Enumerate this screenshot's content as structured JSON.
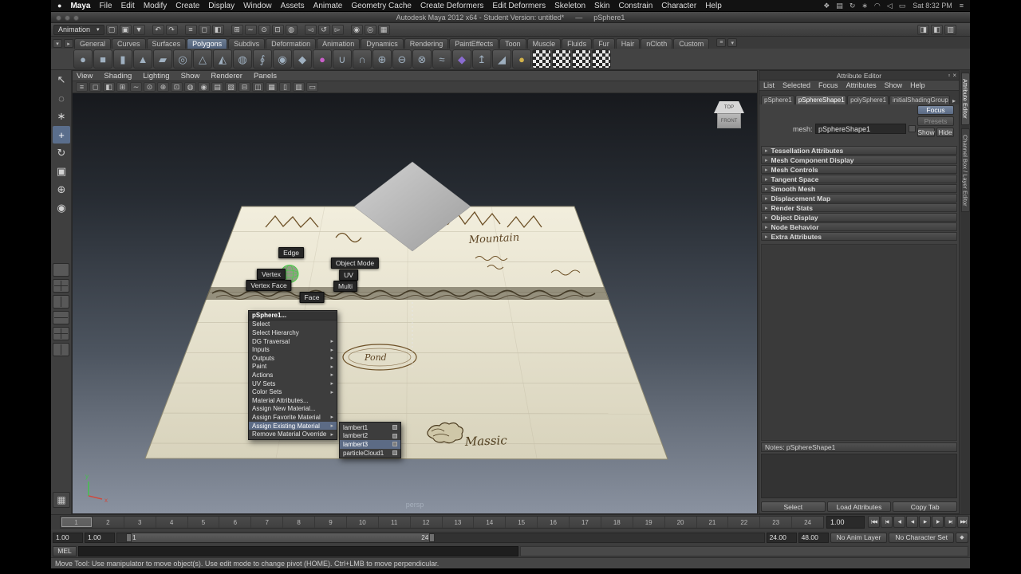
{
  "menubar": {
    "apple_icon": "●",
    "app_name": "Maya",
    "items": [
      "File",
      "Edit",
      "Modify",
      "Create",
      "Display",
      "Window",
      "Assets",
      "Animate",
      "Geometry Cache",
      "Create Deformers",
      "Edit Deformers",
      "Skeleton",
      "Skin",
      "Constrain",
      "Character",
      "Help"
    ],
    "status_icons": [
      {
        "name": "spaces-icon",
        "glyph": "❖"
      },
      {
        "name": "display-icon",
        "glyph": "▤"
      },
      {
        "name": "time-machine-icon",
        "glyph": "↻"
      },
      {
        "name": "bluetooth-icon",
        "glyph": "∗"
      },
      {
        "name": "wifi-icon",
        "glyph": "◠"
      },
      {
        "name": "volume-icon",
        "glyph": "◁"
      },
      {
        "name": "battery-icon",
        "glyph": "▭"
      }
    ],
    "clock": "Sat 8:32 PM",
    "user_menu_icon": "≡"
  },
  "titlebar": {
    "title": "Autodesk Maya 2012 x64 - Student Version: untitled*",
    "separator": "—",
    "document": "pSphere1"
  },
  "statusline": {
    "menuset": "Animation",
    "caret": "▾",
    "icons": [
      {
        "name": "new-scene-icon",
        "glyph": "▢"
      },
      {
        "name": "open-scene-icon",
        "glyph": "▣"
      },
      {
        "name": "save-scene-icon",
        "glyph": "▼"
      },
      {
        "name": "undo-icon",
        "glyph": "↶",
        "cls": "gs"
      },
      {
        "name": "redo-icon",
        "glyph": "↷"
      },
      {
        "name": "select-hierarchy-icon",
        "glyph": "≡",
        "cls": "gs"
      },
      {
        "name": "select-object-icon",
        "glyph": "◻"
      },
      {
        "name": "select-component-icon",
        "glyph": "◧"
      },
      {
        "name": "snap-grid-icon",
        "glyph": "⊞",
        "cls": "gs"
      },
      {
        "name": "snap-curve-icon",
        "glyph": "∼"
      },
      {
        "name": "snap-point-icon",
        "glyph": "⊙"
      },
      {
        "name": "snap-plane-icon",
        "glyph": "⊡"
      },
      {
        "name": "make-live-icon",
        "glyph": "◍"
      },
      {
        "name": "input-connections-icon",
        "glyph": "◅",
        "cls": "gs"
      },
      {
        "name": "construction-history-icon",
        "glyph": "↺"
      },
      {
        "name": "output-connections-icon",
        "glyph": "▻"
      },
      {
        "name": "render-icon",
        "glyph": "◉",
        "cls": "gs"
      },
      {
        "name": "ipr-render-icon",
        "glyph": "◎"
      },
      {
        "name": "render-settings-icon",
        "glyph": "▦"
      }
    ],
    "right_icons": [
      {
        "name": "show-attribute-editor-icon",
        "glyph": "◨"
      },
      {
        "name": "show-tool-settings-icon",
        "glyph": "◧"
      },
      {
        "name": "show-channel-box-icon",
        "glyph": "▥"
      }
    ]
  },
  "shelf": {
    "arrow_icons": [
      {
        "name": "shelf-tab-toggle-icon",
        "glyph": "▾"
      },
      {
        "name": "shelf-menu-icon",
        "glyph": "▸"
      }
    ],
    "tabs": [
      {
        "label": "General"
      },
      {
        "label": "Curves"
      },
      {
        "label": "Surfaces"
      },
      {
        "label": "Polygons",
        "cls": "active"
      },
      {
        "label": "Subdivs"
      },
      {
        "label": "Deformation"
      },
      {
        "label": "Animation"
      },
      {
        "label": "Dynamics"
      },
      {
        "label": "Rendering"
      },
      {
        "label": "PaintEffects"
      },
      {
        "label": "Toon"
      },
      {
        "label": "Muscle"
      },
      {
        "label": "Fluids"
      },
      {
        "label": "Fur"
      },
      {
        "label": "Hair"
      },
      {
        "label": "nCloth"
      },
      {
        "label": "Custom"
      }
    ],
    "right_icons": [
      {
        "name": "shelf-editor-icon",
        "glyph": "≡"
      },
      {
        "name": "shelf-overflow-icon",
        "glyph": "▾"
      }
    ],
    "icons": [
      {
        "name": "poly-sphere-icon",
        "glyph": "●"
      },
      {
        "name": "poly-cube-icon",
        "glyph": "■"
      },
      {
        "name": "poly-cylinder-icon",
        "glyph": "▮"
      },
      {
        "name": "poly-cone-icon",
        "glyph": "▲"
      },
      {
        "name": "poly-plane-icon",
        "glyph": "▰"
      },
      {
        "name": "poly-torus-icon",
        "glyph": "◎"
      },
      {
        "name": "poly-prism-icon",
        "glyph": "△"
      },
      {
        "name": "poly-pyramid-icon",
        "glyph": "◭"
      },
      {
        "name": "poly-pipe-icon",
        "glyph": "◍"
      },
      {
        "name": "poly-helix-icon",
        "glyph": "∮"
      },
      {
        "name": "poly-soccerball-icon",
        "glyph": "◉"
      },
      {
        "name": "poly-platonic-icon",
        "glyph": "◆"
      },
      {
        "name": "sculpt-geometry-icon",
        "glyph": "●",
        "color": "#c95fc9"
      },
      {
        "name": "combine-icon",
        "glyph": "∪"
      },
      {
        "name": "separate-icon",
        "glyph": "∩"
      },
      {
        "name": "boolean-union-icon",
        "glyph": "⊕"
      },
      {
        "name": "boolean-difference-icon",
        "glyph": "⊖"
      },
      {
        "name": "boolean-intersection-icon",
        "glyph": "⊗"
      },
      {
        "name": "smooth-icon",
        "glyph": "≈"
      },
      {
        "name": "mirror-geometry-icon",
        "glyph": "◆",
        "color": "#8a6cd0"
      },
      {
        "name": "extrude-icon",
        "glyph": "↥"
      },
      {
        "name": "bevel-icon",
        "glyph": "◢"
      },
      {
        "name": "spherical-mapping-icon",
        "glyph": "●",
        "color": "#d2b24a"
      },
      {
        "name": "planar-mapping-icon",
        "glyph": "",
        "cls": "checker"
      },
      {
        "name": "cylindrical-mapping-icon",
        "glyph": "",
        "cls": "checker"
      },
      {
        "name": "automatic-mapping-icon",
        "glyph": "",
        "cls": "checker"
      },
      {
        "name": "uv-texture-editor-icon",
        "glyph": "",
        "cls": "checker"
      }
    ]
  },
  "toolbox": {
    "tools": [
      {
        "name": "select-tool",
        "glyph": "↖"
      },
      {
        "name": "lasso-select-tool",
        "glyph": "◌"
      },
      {
        "name": "paint-select-tool",
        "glyph": "∗"
      },
      {
        "name": "move-tool",
        "glyph": "+",
        "cls": "active"
      },
      {
        "name": "rotate-tool",
        "glyph": "↻"
      },
      {
        "name": "scale-tool",
        "glyph": "▣"
      },
      {
        "name": "universal-manipulator-tool",
        "glyph": "⊕"
      },
      {
        "name": "soft-modification-tool",
        "glyph": "◉"
      }
    ],
    "layouts": [
      {
        "name": "single-pane-layout",
        "cls": "lay1"
      },
      {
        "name": "four-pane-layout",
        "cls": "lay2"
      },
      {
        "name": "two-pane-vertical-layout",
        "cls": "lay3"
      },
      {
        "name": "two-pane-horizontal-layout",
        "cls": "lay4"
      },
      {
        "name": "three-pane-layout",
        "cls": "lay2"
      },
      {
        "name": "outliner-persp-layout",
        "cls": "lay3"
      }
    ],
    "bottom_icon_glyph": "▦"
  },
  "viewport": {
    "menus": [
      "View",
      "Shading",
      "Lighting",
      "Show",
      "Renderer",
      "Panels"
    ],
    "toolbar_icons": [
      {
        "name": "select-by-hierarchy-icon",
        "glyph": "≡"
      },
      {
        "name": "select-by-object-icon",
        "glyph": "◻"
      },
      {
        "name": "select-by-component-icon",
        "glyph": "◧"
      },
      {
        "name": "snap-to-grids-icon",
        "glyph": "⊞"
      },
      {
        "name": "snap-to-curves-icon",
        "glyph": "∼"
      },
      {
        "name": "snap-to-points-icon",
        "glyph": "⊙"
      },
      {
        "name": "snap-to-projected-center-icon",
        "glyph": "⊕"
      },
      {
        "name": "snap-to-view-planes-icon",
        "glyph": "⊡"
      },
      {
        "name": "make-live-icon",
        "glyph": "◍"
      },
      {
        "name": "camera-attributes-icon",
        "glyph": "◉"
      },
      {
        "name": "bookmark-icon",
        "glyph": "▤"
      },
      {
        "name": "image-plane-icon",
        "glyph": "▧"
      },
      {
        "name": "two-d-pan-zoom-icon",
        "glyph": "⊟"
      },
      {
        "name": "isolate-select-icon",
        "glyph": "◫"
      },
      {
        "name": "field-chart-icon",
        "glyph": "▦"
      },
      {
        "name": "resolution-gate-icon",
        "glyph": "▯"
      },
      {
        "name": "gate-mask-icon",
        "glyph": "▥"
      },
      {
        "name": "safe-title-icon",
        "glyph": "▭"
      }
    ],
    "camera_label": "persp",
    "axis_x": "x",
    "axis_y": "y",
    "viewcube": {
      "top_label": "TOP",
      "front_label": "FRONT"
    }
  },
  "map": {
    "mountain_label": "Mountain",
    "pond_label": "Pond",
    "massic_label": "Massic"
  },
  "marking_menu": {
    "edge": "Edge",
    "object_mode": "Object Mode",
    "vertex": "Vertex",
    "uv": "UV",
    "vertex_face": "Vertex Face",
    "multi": "Multi",
    "face": "Face"
  },
  "context_menu": {
    "items": [
      {
        "label": "pSphere1...",
        "cls": "cm-header"
      },
      {
        "label": "Select"
      },
      {
        "label": "Select Hierarchy"
      },
      {
        "label": "DG Traversal",
        "arrow": "▸"
      },
      {
        "label": "Inputs",
        "arrow": "▸"
      },
      {
        "label": "Outputs",
        "arrow": "▸"
      },
      {
        "label": "Paint",
        "arrow": "▸"
      },
      {
        "label": "Actions",
        "arrow": "▸"
      },
      {
        "label": "UV Sets",
        "arrow": "▸"
      },
      {
        "label": "Color Sets",
        "arrow": "▸"
      },
      {
        "label": "Material Attributes..."
      },
      {
        "label": "Assign New Material..."
      },
      {
        "label": "Assign Favorite Material",
        "arrow": "▸"
      },
      {
        "label": "Assign Existing Material",
        "arrow": "▸",
        "cls": "hl"
      },
      {
        "label": "Remove Material Override",
        "arrow": "▸"
      }
    ]
  },
  "material_submenu": {
    "items": [
      {
        "label": "lambert1"
      },
      {
        "label": "lambert2"
      },
      {
        "label": "lambert3",
        "cls": "hl"
      },
      {
        "label": "particleCloud1"
      }
    ]
  },
  "attribute_editor": {
    "title": "Attribute Editor",
    "window_icons": [
      {
        "name": "ae-dock-icon",
        "glyph": "▫"
      },
      {
        "name": "ae-close-icon",
        "glyph": "×"
      }
    ],
    "menus": [
      "List",
      "Selected",
      "Focus",
      "Attributes",
      "Show",
      "Help"
    ],
    "tabs": [
      {
        "label": "pSphere1"
      },
      {
        "label": "pSphereShape1",
        "cls": "active"
      },
      {
        "label": "polySphere1"
      },
      {
        "label": "initialShadingGroup"
      }
    ],
    "tab_overflow": "▸",
    "focus_button": "Focus",
    "presets_button": "Presets",
    "show_button": "Show",
    "hide_button": "Hide",
    "mesh_label": "mesh:",
    "mesh_value": "pSphereShape1",
    "section_arrow": "▸",
    "sections": [
      "Tessellation Attributes",
      "Mesh Component Display",
      "Mesh Controls",
      "Tangent Space",
      "Smooth Mesh",
      "Displacement Map",
      "Render Stats",
      "Object Display",
      "Node Behavior",
      "Extra Attributes"
    ],
    "notes_label": "Notes: pSphereShape1",
    "buttons": [
      "Select",
      "Load Attributes",
      "Copy Tab"
    ]
  },
  "side_tabs": [
    {
      "label": "Attribute Editor",
      "cls": "active"
    },
    {
      "label": "Channel Box / Layer Editor"
    }
  ],
  "timeline": {
    "frames": [
      "1",
      "2",
      "3",
      "4",
      "5",
      "6",
      "7",
      "8",
      "9",
      "10",
      "11",
      "12",
      "13",
      "14",
      "15",
      "16",
      "17",
      "18",
      "19",
      "20",
      "21",
      "22",
      "23",
      "24"
    ],
    "current_time": "1.00"
  },
  "playback": {
    "buttons": [
      {
        "name": "go-to-start-button",
        "glyph": "|◀◀"
      },
      {
        "name": "step-back-frame-button",
        "glyph": "|◀"
      },
      {
        "name": "step-back-key-button",
        "glyph": "◀|"
      },
      {
        "name": "play-backwards-button",
        "glyph": "◀"
      },
      {
        "name": "play-forwards-button",
        "glyph": "▶"
      },
      {
        "name": "step-forward-key-button",
        "glyph": "|▶"
      },
      {
        "name": "step-forward-frame-button",
        "glyph": "▶|"
      },
      {
        "name": "go-to-end-button",
        "glyph": "▶▶|"
      }
    ]
  },
  "range_slider": {
    "min_field": "1.00",
    "playback_min_field": "1.00",
    "inner_min": "1",
    "inner_max": "24",
    "playback_max_field": "24.00",
    "max_field": "48.00",
    "anim_layer": "No Anim Layer",
    "character_set": "No Character Set",
    "key_icon": "◆"
  },
  "command_line": {
    "label": "MEL"
  },
  "help_line": {
    "text": "Move Tool: Use manipulator to move object(s). Use edit mode to change pivot (HOME). Ctrl+LMB to move perpendicular."
  }
}
